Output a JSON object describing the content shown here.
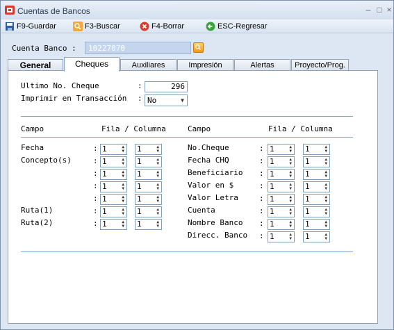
{
  "window": {
    "title": "Cuentas de Bancos"
  },
  "toolbar": {
    "guardar": "F9-Guardar",
    "buscar": "F3-Buscar",
    "borrar": "F4-Borrar",
    "regresar": "ESC-Regresar"
  },
  "cuenta": {
    "label": "Cuenta Banco",
    "colon": ":",
    "value": "10227070"
  },
  "tabs": [
    "General",
    "Cheques",
    "Auxiliares",
    "Impresión",
    "Alertas",
    "Proyecto/Prog."
  ],
  "cheques": {
    "ultimo_label": "Ultimo No. Cheque",
    "ultimo_value": "296",
    "imprimir_label": "Imprimir en Transacción",
    "imprimir_value": "No",
    "colon": ":",
    "header_campo": "Campo",
    "header_fila_columna": "Fila / Columna",
    "left_fields": [
      "Fecha",
      "Concepto(s)",
      "",
      "",
      "",
      "Ruta(1)",
      "Ruta(2)"
    ],
    "right_fields": [
      "No.Cheque",
      "Fecha CHQ",
      "Beneficiario",
      "Valor en $",
      "Valor Letra",
      "Cuenta",
      "Nombre Banco",
      "Direcc. Banco"
    ],
    "spin_value": "1"
  }
}
